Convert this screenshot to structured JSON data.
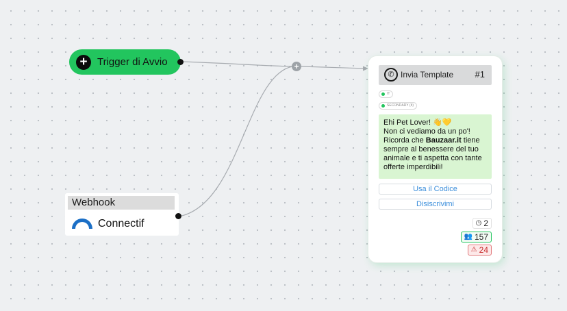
{
  "trigger": {
    "label": "Trigger di Avvio",
    "icon": "plus-icon"
  },
  "merge": {
    "icon": "plus-icon"
  },
  "webhook": {
    "header": "Webhook",
    "source_label": "Connectif",
    "logo": "connectif-logo"
  },
  "template_card": {
    "icon": "whatsapp-icon",
    "title": "Invia Template",
    "number": "#1",
    "tags": [
      {
        "label": "IT",
        "color": "#22c55e"
      },
      {
        "label": "SECONDARY (It)",
        "color": "#22c55e"
      }
    ],
    "message": {
      "line1": "Ehi Pet Lover! 👋💛",
      "line2": "Non ci vediamo da un po'!",
      "line3_before": "Ricorda che ",
      "line3_bold": "Bauzaar.it",
      "line3_after": " tiene",
      "line4": "sempre al benessere del tuo",
      "line5": "animale e ti aspetta con tante",
      "line6": "offerte imperdibili!"
    },
    "buttons": [
      "Usa il Codice",
      "Disiscrivimi"
    ],
    "stats": {
      "time": {
        "icon": "clock-icon",
        "value": "2"
      },
      "users": {
        "icon": "users-icon",
        "value": "157",
        "color": "#22c55e"
      },
      "alerts": {
        "icon": "warning-icon",
        "value": "24",
        "color": "#e53935"
      }
    }
  },
  "colors": {
    "accent_green": "#22c55e",
    "wire": "#a7abb0",
    "connectif_blue": "#1b6fc6"
  }
}
